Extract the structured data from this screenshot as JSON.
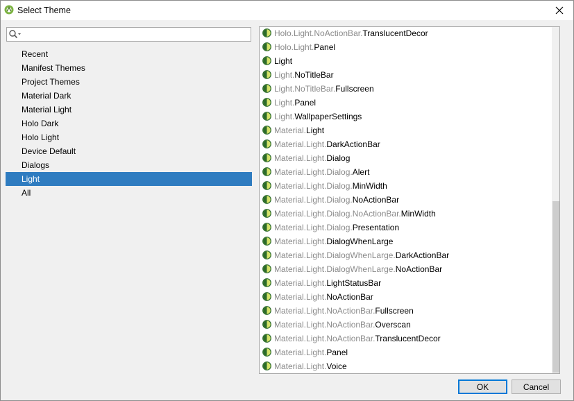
{
  "window": {
    "title": "Select Theme",
    "close_glyph": "✕",
    "app_icon": "android-studio-icon"
  },
  "search": {
    "value": "",
    "placeholder": "",
    "icon": "search-icon"
  },
  "categories": [
    {
      "label": "Recent",
      "selected": false
    },
    {
      "label": "Manifest Themes",
      "selected": false
    },
    {
      "label": "Project Themes",
      "selected": false
    },
    {
      "label": "Material Dark",
      "selected": false
    },
    {
      "label": "Material Light",
      "selected": false
    },
    {
      "label": "Holo Dark",
      "selected": false
    },
    {
      "label": "Holo Light",
      "selected": false
    },
    {
      "label": "Device Default",
      "selected": false
    },
    {
      "label": "Dialogs",
      "selected": false
    },
    {
      "label": "Light",
      "selected": true
    },
    {
      "label": "All",
      "selected": false
    }
  ],
  "themes": [
    {
      "prefix": "Holo.Light.NoActionBar.",
      "name": "TranslucentDecor"
    },
    {
      "prefix": "Holo.Light.",
      "name": "Panel"
    },
    {
      "prefix": "",
      "name": "Light"
    },
    {
      "prefix": "Light.",
      "name": "NoTitleBar"
    },
    {
      "prefix": "Light.NoTitleBar.",
      "name": "Fullscreen"
    },
    {
      "prefix": "Light.",
      "name": "Panel"
    },
    {
      "prefix": "Light.",
      "name": "WallpaperSettings"
    },
    {
      "prefix": "Material.",
      "name": "Light"
    },
    {
      "prefix": "Material.Light.",
      "name": "DarkActionBar"
    },
    {
      "prefix": "Material.Light.",
      "name": "Dialog"
    },
    {
      "prefix": "Material.Light.Dialog.",
      "name": "Alert"
    },
    {
      "prefix": "Material.Light.Dialog.",
      "name": "MinWidth"
    },
    {
      "prefix": "Material.Light.Dialog.",
      "name": "NoActionBar"
    },
    {
      "prefix": "Material.Light.Dialog.NoActionBar.",
      "name": "MinWidth"
    },
    {
      "prefix": "Material.Light.Dialog.",
      "name": "Presentation"
    },
    {
      "prefix": "Material.Light.",
      "name": "DialogWhenLarge"
    },
    {
      "prefix": "Material.Light.DialogWhenLarge.",
      "name": "DarkActionBar"
    },
    {
      "prefix": "Material.Light.DialogWhenLarge.",
      "name": "NoActionBar"
    },
    {
      "prefix": "Material.Light.",
      "name": "LightStatusBar"
    },
    {
      "prefix": "Material.Light.",
      "name": "NoActionBar"
    },
    {
      "prefix": "Material.Light.NoActionBar.",
      "name": "Fullscreen"
    },
    {
      "prefix": "Material.Light.NoActionBar.",
      "name": "Overscan"
    },
    {
      "prefix": "Material.Light.NoActionBar.",
      "name": "TranslucentDecor"
    },
    {
      "prefix": "Material.Light.",
      "name": "Panel"
    },
    {
      "prefix": "Material.Light.",
      "name": "Voice"
    }
  ],
  "buttons": {
    "ok": "OK",
    "cancel": "Cancel"
  },
  "colors": {
    "selection": "#2f7cc0",
    "muted_text": "#8a8a8a",
    "theme_icon_ring": "#2b6b2b",
    "theme_icon_fill": "#d6e36a"
  }
}
